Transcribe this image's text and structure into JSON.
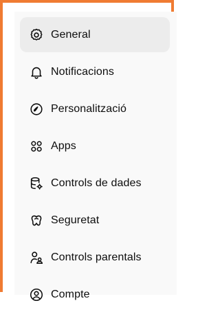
{
  "accent_border_color": "#f07b32",
  "menu": {
    "items": [
      {
        "label": "General",
        "icon": "gear-icon",
        "active": true
      },
      {
        "label": "Notificacions",
        "icon": "bell-icon",
        "active": false
      },
      {
        "label": "Personalització",
        "icon": "customize-icon",
        "active": false
      },
      {
        "label": "Apps",
        "icon": "apps-grid-icon",
        "active": false
      },
      {
        "label": "Controls de dades",
        "icon": "database-settings-icon",
        "active": false
      },
      {
        "label": "Seguretat",
        "icon": "security-icon",
        "active": false
      },
      {
        "label": "Controls parentals",
        "icon": "parental-controls-icon",
        "active": false
      },
      {
        "label": "Compte",
        "icon": "account-icon",
        "active": false
      }
    ]
  }
}
